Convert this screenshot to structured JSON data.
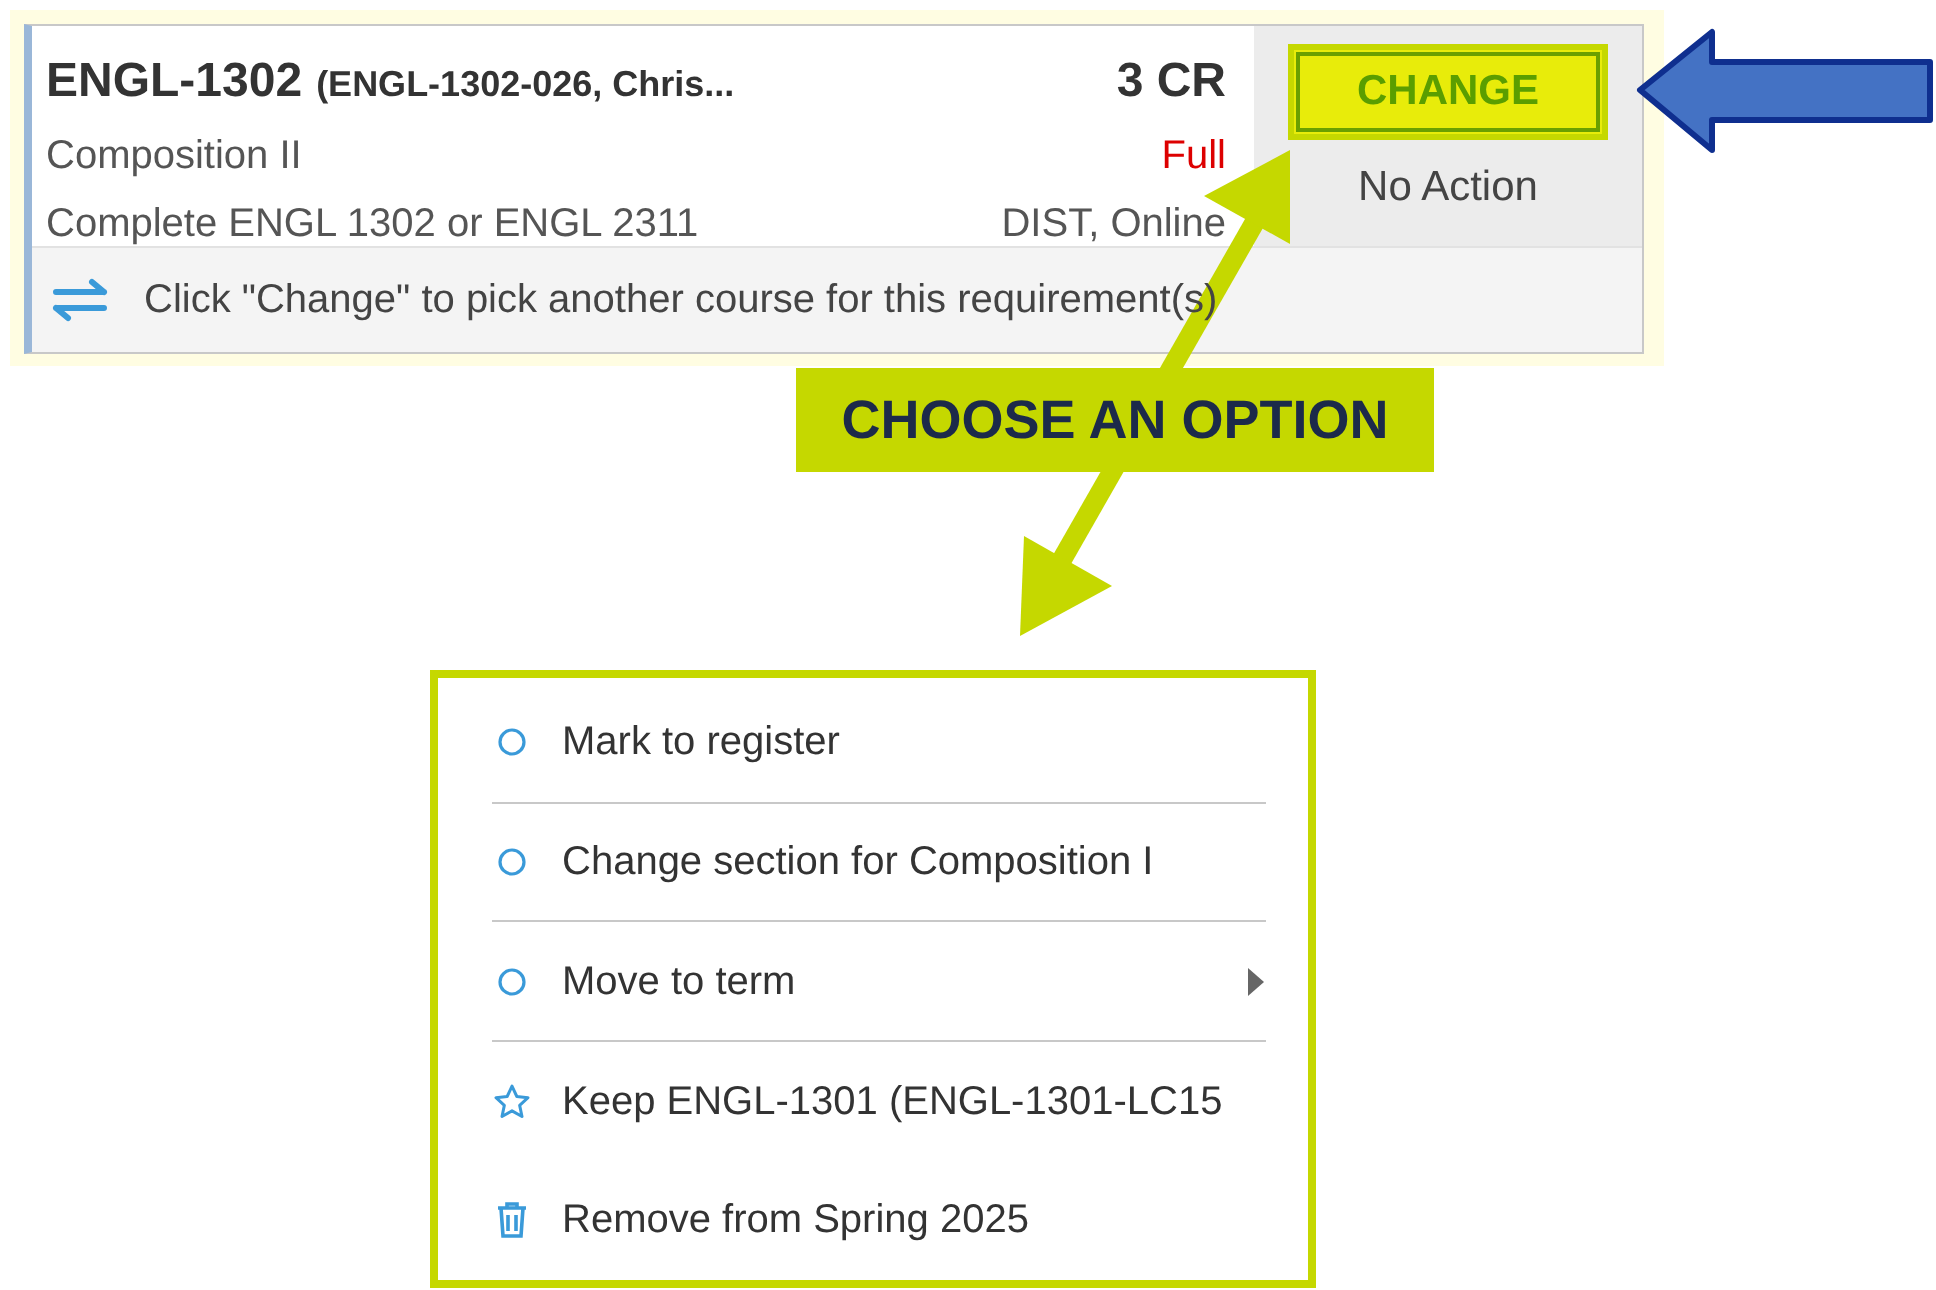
{
  "course": {
    "code": "ENGL-1302",
    "section": "(ENGL-1302-026, Chris...",
    "credits": "3 CR",
    "title": "Composition II",
    "status": "Full",
    "requirement": "Complete ENGL 1302 or ENGL 2311",
    "delivery": "DIST, Online",
    "action_button": "CHANGE",
    "action_state": "No Action",
    "hint": "Click \"Change\" to pick another course for this requirement(s)"
  },
  "callout": "CHOOSE AN OPTION",
  "menu": [
    {
      "kind": "radio",
      "label": "Mark to register",
      "submenu": false
    },
    {
      "kind": "radio",
      "label": "Change section for Composition I",
      "submenu": false
    },
    {
      "kind": "radio",
      "label": "Move to term",
      "submenu": true
    },
    {
      "kind": "star",
      "label": "Keep ENGL-1301 (ENGL-1301-LC15",
      "submenu": false
    },
    {
      "kind": "trash",
      "label": "Remove from Spring 2025",
      "submenu": false
    }
  ]
}
